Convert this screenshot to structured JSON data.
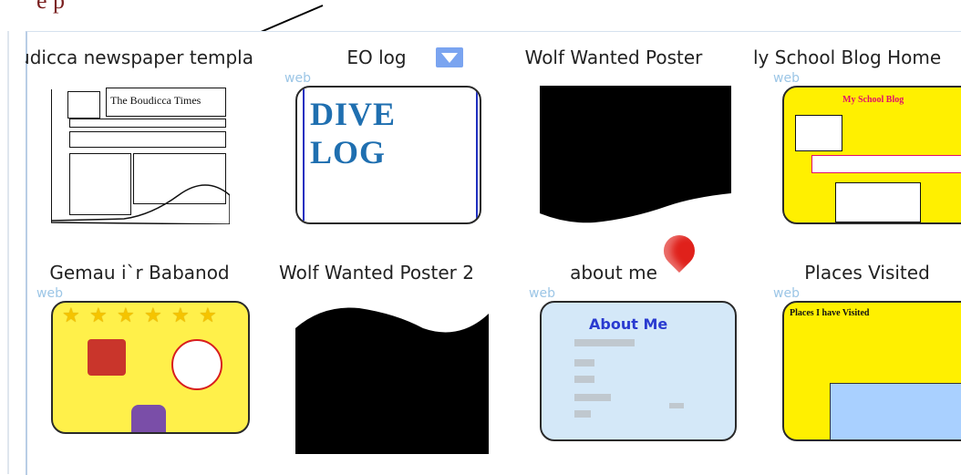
{
  "callout": {
    "text": "e p"
  },
  "web_tag": "web",
  "grid": {
    "rows": [
      [
        {
          "title": "udicca newspaper templa",
          "web": false,
          "preview": "newspaper"
        },
        {
          "title": "EO log",
          "web": true,
          "preview": "dive"
        },
        {
          "title": "Wolf Wanted Poster",
          "web": false,
          "preview": "black"
        },
        {
          "title": "ly School Blog Home",
          "web": true,
          "preview": "blog"
        }
      ],
      [
        {
          "title": "Gemau i`r Babanod",
          "web": true,
          "preview": "stars"
        },
        {
          "title": "Wolf Wanted Poster 2",
          "web": false,
          "preview": "black2"
        },
        {
          "title": "about me",
          "web": true,
          "preview": "about"
        },
        {
          "title": "Places Visited",
          "web": true,
          "preview": "places"
        }
      ]
    ]
  },
  "thumb_text": {
    "boudicca_title": "The Boudicca Times",
    "dive_title": "DIVE LOG",
    "blog_title": "My School Blog",
    "about_title": "About Me",
    "places_title": "Places I have Visited"
  },
  "colors": {
    "web_text": "#9cc6e6",
    "accent_blue": "#7aa4f0",
    "yellow": "#fff000",
    "pin_red": "#e0211b"
  }
}
